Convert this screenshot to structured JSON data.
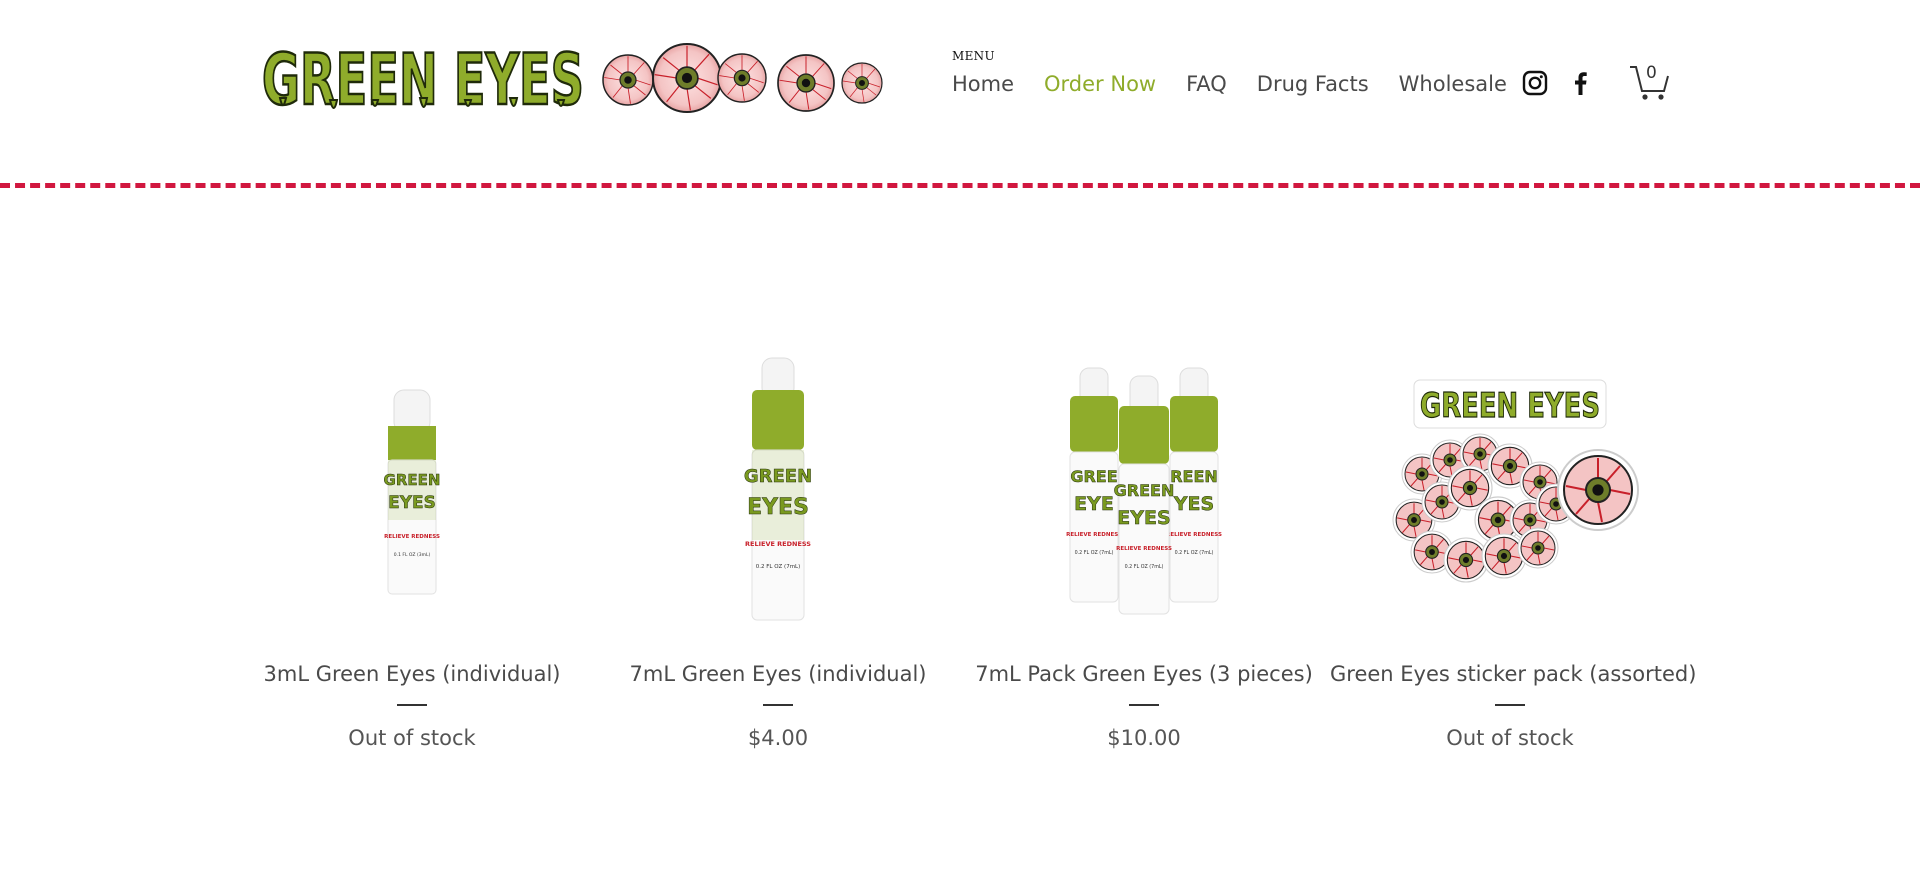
{
  "brand": {
    "name": "GREEN EYES",
    "logo_icon": "bloodshot-eyeball-icon"
  },
  "colors": {
    "accent": "#8fac2b",
    "divider": "#d1173f",
    "text": "#4a4a4a"
  },
  "header": {
    "menu_label": "MENU",
    "nav": [
      {
        "label": "Home",
        "active": false
      },
      {
        "label": "Order Now",
        "active": true
      },
      {
        "label": "FAQ",
        "active": false
      },
      {
        "label": "Drug Facts",
        "active": false
      },
      {
        "label": "Wholesale",
        "active": false
      }
    ],
    "social": [
      "instagram-icon",
      "facebook-icon"
    ],
    "cart_count": "0"
  },
  "products": [
    {
      "name": "3mL Green Eyes (individual)",
      "price": "Out of stock",
      "image": "3ml-bottle-image",
      "bottle_label": "0.1 FL OZ (3mL)"
    },
    {
      "name": "7mL Green Eyes (individual)",
      "price": "$4.00",
      "image": "7ml-bottle-image",
      "bottle_label": "0.2 FL OZ (7mL)"
    },
    {
      "name": "7mL Pack Green Eyes (3 pieces)",
      "price": "$10.00",
      "image": "7ml-3-pack-image",
      "bottle_label": "0.2 FL OZ (7mL)"
    },
    {
      "name": "Green Eyes sticker pack (assorted)",
      "price": "Out of stock",
      "image": "sticker-pack-image"
    }
  ],
  "bottle_tagline": "RELIEVE REDNESS"
}
